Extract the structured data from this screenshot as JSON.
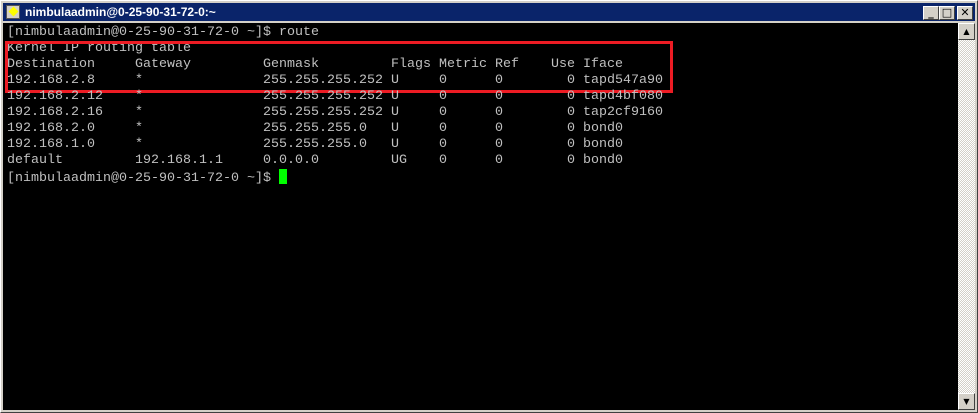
{
  "window": {
    "title": "nimbulaadmin@0-25-90-31-72-0:~",
    "buttons": [
      "minimize",
      "maximize",
      "close"
    ]
  },
  "terminal": {
    "prompt": "[nimbulaadmin@0-25-90-31-72-0 ~]$ ",
    "command": "route",
    "table_title": "Kernel IP routing table",
    "headers": [
      "Destination",
      "Gateway",
      "Genmask",
      "Flags",
      "Metric",
      "Ref",
      "Use",
      "Iface"
    ],
    "rows": [
      [
        "192.168.2.8",
        "*",
        "255.255.255.252",
        "U",
        "0",
        "0",
        "0",
        "tapd547a90"
      ],
      [
        "192.168.2.12",
        "*",
        "255.255.255.252",
        "U",
        "0",
        "0",
        "0",
        "tapd4bf080"
      ],
      [
        "192.168.2.16",
        "*",
        "255.255.255.252",
        "U",
        "0",
        "0",
        "0",
        "tap2cf9160"
      ],
      [
        "192.168.2.0",
        "*",
        "255.255.255.0",
        "U",
        "0",
        "0",
        "0",
        "bond0"
      ],
      [
        "192.168.1.0",
        "*",
        "255.255.255.0",
        "U",
        "0",
        "0",
        "0",
        "bond0"
      ],
      [
        "default",
        "192.168.1.1",
        "0.0.0.0",
        "UG",
        "0",
        "0",
        "0",
        "bond0"
      ]
    ],
    "final_prompt": "[nimbulaadmin@0-25-90-31-72-0 ~]$ ",
    "highlight_color": "#ed1c24",
    "cursor_color": "#00ff00"
  }
}
